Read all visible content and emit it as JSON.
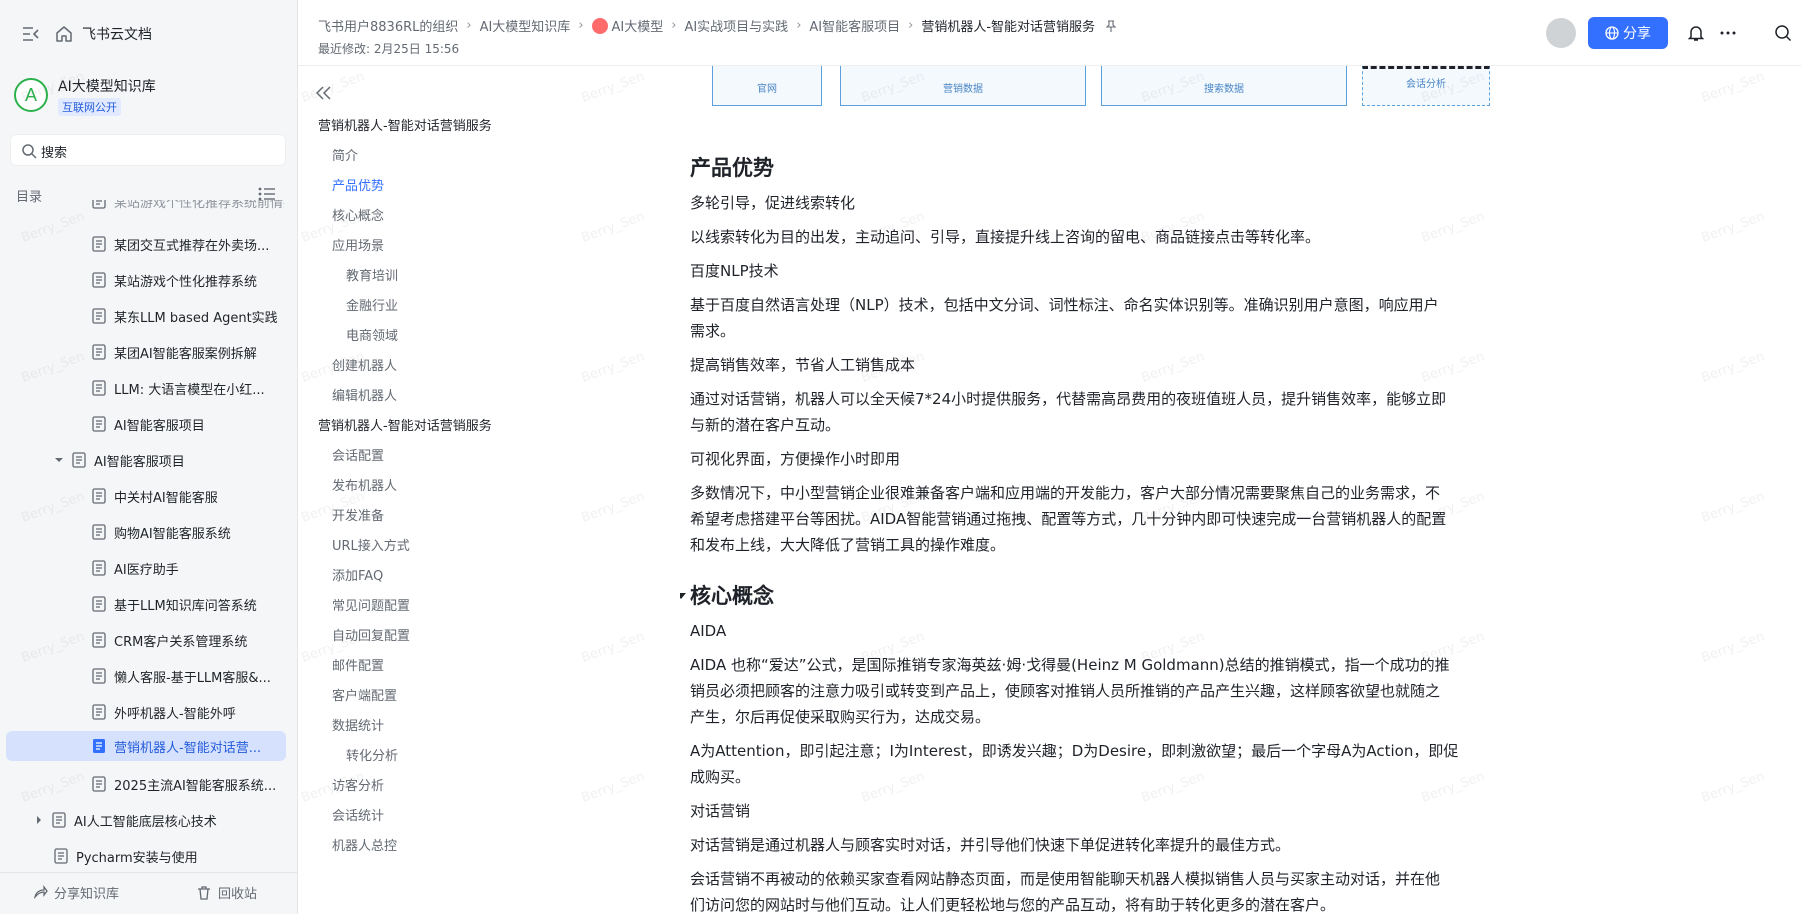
{
  "sidebar": {
    "app_title": "飞书云文档",
    "kb_avatar": "A",
    "kb_name": "AI大模型知识库",
    "kb_badge": "互联网公开",
    "search_placeholder": "搜索",
    "toc_label": "目录",
    "tree": [
      {
        "label": "某站游戏个性化推荐系统前情提要"
      },
      {
        "label": "某团交互式推荐在外卖场..."
      },
      {
        "label": "某站游戏个性化推荐系统"
      },
      {
        "label": "某东LLM based Agent实践"
      },
      {
        "label": "某团AI智能客服案例拆解"
      },
      {
        "label": "LLM: 大语言模型在小红..."
      },
      {
        "label": "AI智能客服项目"
      },
      {
        "label": "AI智能客服项目"
      },
      {
        "label": "中关村AI智能客服"
      },
      {
        "label": "购物AI智能客服系统"
      },
      {
        "label": "AI医疗助手"
      },
      {
        "label": "基于LLM知识库问答系统"
      },
      {
        "label": "CRM客户关系管理系统"
      },
      {
        "label": "懒人客服-基于LLM客服&..."
      },
      {
        "label": "外呼机器人-智能外呼"
      },
      {
        "label": "营销机器人-智能对话营..."
      },
      {
        "label": "2025主流AI智能客服系统..."
      },
      {
        "label": "AI人工智能底层核心技术"
      },
      {
        "label": "Pycharm安装与使用"
      }
    ],
    "bottom_share": "分享知识库",
    "bottom_trash": "回收站"
  },
  "header": {
    "breadcrumb": [
      "飞书用户8836RL的组织",
      "AI大模型知识库",
      "AI大模型",
      "AI实战项目与实践",
      "AI智能客服项目",
      "营销机器人-智能对话营销服务"
    ],
    "modified": "最近修改: 2月25日 15:56",
    "share_label": "分享"
  },
  "outline": {
    "items": [
      {
        "label": "营销机器人-智能对话营销服务"
      },
      {
        "label": "简介"
      },
      {
        "label": "产品优势"
      },
      {
        "label": "核心概念"
      },
      {
        "label": "应用场景"
      },
      {
        "label": "教育培训"
      },
      {
        "label": "金融行业"
      },
      {
        "label": "电商领域"
      },
      {
        "label": "创建机器人"
      },
      {
        "label": "编辑机器人"
      },
      {
        "label": "营销机器人-智能对话营销服务"
      },
      {
        "label": "会话配置"
      },
      {
        "label": "发布机器人"
      },
      {
        "label": "开发准备"
      },
      {
        "label": "URL接入方式"
      },
      {
        "label": "添加FAQ"
      },
      {
        "label": "常见问题配置"
      },
      {
        "label": "自动回复配置"
      },
      {
        "label": "邮件配置"
      },
      {
        "label": "客户端配置"
      },
      {
        "label": "数据统计"
      },
      {
        "label": "转化分析"
      },
      {
        "label": "访客分析"
      },
      {
        "label": "会话统计"
      },
      {
        "label": "机器人总控"
      }
    ]
  },
  "doc": {
    "figure_boxes": [
      "官网",
      "营销数据",
      "搜索数据",
      "会话分析"
    ],
    "h_advantage": "产品优势",
    "p1": "多轮引导，促进线索转化",
    "p2": "以线索转化为目的出发，主动追问、引导，直接提升线上咨询的留电、商品链接点击等转化率。",
    "p3": "百度NLP技术",
    "p4a": "基于百度自然语言处理（NLP）技术，包括中文分词、词性标注、命名实体识别等。准确识别用户意图，响应用户",
    "p4b": "需求。",
    "p5": "提高销售效率，节省人工销售成本",
    "p6a": "通过对话营销，机器人可以全天候7*24小时提供服务，代替需高昂费用的夜班值班人员，提升销售效率，能够立即",
    "p6b": "与新的潜在客户互动。",
    "p7": "可视化界面，方便操作小时即用",
    "p8a": "多数情况下，中小型营销企业很难兼备客户端和应用端的开发能力，客户大部分情况需要聚焦自己的业务需求，不",
    "p8b": "希望考虑搭建平台等困扰。AIDA智能营销通过拖拽、配置等方式，几十分钟内即可快速完成一台营销机器人的配置",
    "p8c": "和发布上线，大大降低了营销工具的操作难度。",
    "h_concept": "核心概念",
    "p9": "AIDA",
    "p10a": "AIDA 也称“爱达”公式，是国际推销专家海英兹·姆·戈得曼(Heinz M Goldmann)总结的推销模式，指一个成功的推",
    "p10b": "销员必须把顾客的注意力吸引或转变到产品上，使顾客对推销人员所推销的产品产生兴趣，这样顾客欲望也就随之",
    "p10c": "产生，尔后再促使采取购买行为，达成交易。",
    "p11a": "A为Attention，即引起注意；I为Interest，即诱发兴趣；D为Desire，即刺激欲望；最后一个字母A为Action，即促",
    "p11b": "成购买。",
    "p12": "对话营销",
    "p13": "对话营销是通过机器人与顾客实时对话，并引导他们快速下单促进转化率提升的最佳方式。",
    "p14a": "会话营销不再被动的依赖买家查看网站静态页面，而是使用智能聊天机器人模拟销售人员与买家主动对话，并在他",
    "p14b": "们访问您的网站时与他们互动。让人们更轻松地与您的产品互动，将有助于转化更多的潜在客户。"
  },
  "watermark": "Berry_Sen",
  "colors": {
    "accent": "#3370ff",
    "sidebar_bg": "#f5f6f7",
    "active_bg": "#d6e2fd"
  }
}
